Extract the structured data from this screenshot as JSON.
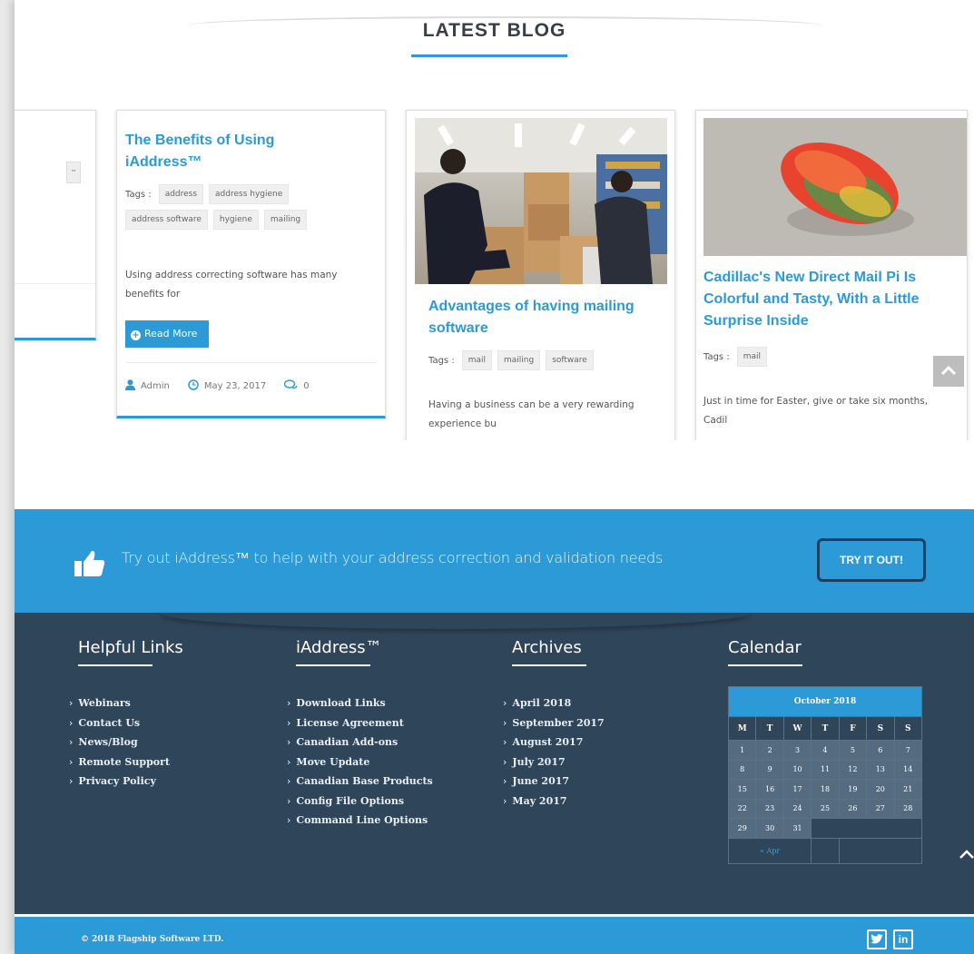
{
  "blog": {
    "section_title": "LATEST BLOG",
    "cards": [
      {
        "title": "The Benefits of Using iAddress™",
        "tags_label": "Tags :",
        "tags": [
          "address",
          "address hygiene",
          "address software",
          "hygiene",
          "mailing"
        ],
        "excerpt": "Using address correcting software has many benefits for",
        "read_more": "Read More",
        "author": "Admin",
        "date": "May 23, 2017",
        "comments": "0"
      },
      {
        "title": "Advantages of having mailing software",
        "tags_label": "Tags :",
        "tags": [
          "mail",
          "mailing",
          "software"
        ],
        "excerpt": "Having a business can be a very rewarding experience bu"
      },
      {
        "title": "Cadillac's New Direct Mail Pi Is Colorful and Tasty, With a Little Surprise Inside",
        "tags_label": "Tags :",
        "tags": [
          "mail"
        ],
        "excerpt": "Just in time for Easter, give or take six months, Cadil"
      }
    ]
  },
  "cta": {
    "text": "Try out iAddress™ to help with your address correction and validation needs",
    "button": "TRY IT OUT!"
  },
  "footer": {
    "columns": [
      {
        "title": "Helpful Links",
        "links": [
          "Webinars",
          "Contact Us",
          "News/Blog",
          "Remote Support",
          "Privacy Policy"
        ]
      },
      {
        "title": "iAddress™",
        "links": [
          "Download Links",
          "License Agreement",
          "Canadian Add-ons",
          "Move Update",
          "Canadian Base Products",
          "Config File Options",
          "Command Line Options"
        ]
      },
      {
        "title": "Archives",
        "links": [
          "April 2018",
          "September 2017",
          "August 2017",
          "July 2017",
          "June 2017",
          "May 2017"
        ]
      }
    ],
    "calendar": {
      "title": "Calendar",
      "month": "October 2018",
      "weekdays": [
        "M",
        "T",
        "W",
        "T",
        "F",
        "S",
        "S"
      ],
      "weeks": [
        [
          "1",
          "2",
          "3",
          "4",
          "5",
          "6",
          "7"
        ],
        [
          "8",
          "9",
          "10",
          "11",
          "12",
          "13",
          "14"
        ],
        [
          "15",
          "16",
          "17",
          "18",
          "19",
          "20",
          "21"
        ],
        [
          "22",
          "23",
          "24",
          "25",
          "26",
          "27",
          "28"
        ],
        [
          "29",
          "30",
          "31",
          "",
          "",
          "",
          ""
        ]
      ],
      "prev": "« Apr"
    }
  },
  "copyright": "© 2018 Flagship Software LTD.",
  "social": {
    "twitter": "t",
    "linkedin": "in"
  },
  "colors": {
    "accent": "#2b9ad6",
    "footer_bg": "#2f4559"
  }
}
